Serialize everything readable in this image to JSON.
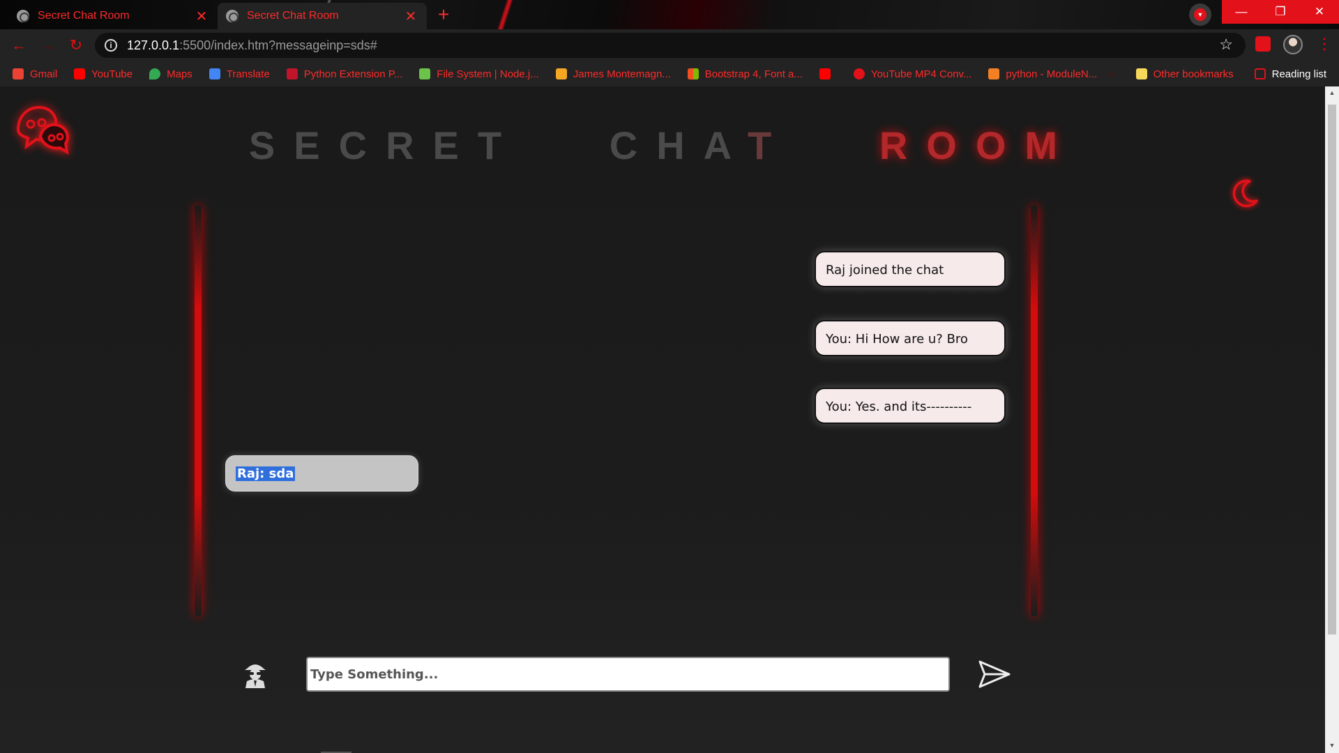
{
  "browser": {
    "tabs": [
      {
        "title": "Secret Chat Room",
        "active": false
      },
      {
        "title": "Secret Chat Room",
        "active": true
      }
    ],
    "url_host": "127.0.0.1",
    "url_rest": ":5500/index.htm?messageinp=sds#",
    "bookmarks": [
      {
        "label": "Gmail",
        "icon": "gmail-icon",
        "color": "#ea4335"
      },
      {
        "label": "YouTube",
        "icon": "youtube-icon",
        "color": "#ff0000"
      },
      {
        "label": "Maps",
        "icon": "maps-icon",
        "color": "#34a853"
      },
      {
        "label": "Translate",
        "icon": "translate-icon",
        "color": "#4285f4"
      },
      {
        "label": "Python Extension P...",
        "icon": "python-extension-icon",
        "color": "#c0142a"
      },
      {
        "label": "File System | Node.j...",
        "icon": "nodejs-icon",
        "color": "#6cc24a"
      },
      {
        "label": "James Montemagn...",
        "icon": "blog-icon",
        "color": "#f5a623"
      },
      {
        "label": "Bootstrap 4, Font a...",
        "icon": "windows-icon",
        "color": "#00a4ef"
      },
      {
        "label": "",
        "icon": "youtube-icon",
        "color": "#ff0000"
      },
      {
        "label": "YouTube MP4 Conv...",
        "icon": "download-icon",
        "color": "#e3111a"
      },
      {
        "label": "python - ModuleN...",
        "icon": "stackoverflow-icon",
        "color": "#f48024"
      }
    ],
    "other_bookmarks": "Other bookmarks",
    "reading_list": "Reading list"
  },
  "app": {
    "title_word1": "SECRET",
    "title_word2a": "CHA",
    "title_word2b": "T",
    "title_word3": "ROOM",
    "accent_color": "#e3111a",
    "messages": [
      {
        "side": "right",
        "text": "Raj joined the chat"
      },
      {
        "side": "right",
        "text": "You: Hi How are u? Bro"
      },
      {
        "side": "right",
        "text": "You: Yes. and its----------"
      },
      {
        "side": "left",
        "text": "Raj: sda",
        "selected": true
      }
    ],
    "input_placeholder": "Type Something...",
    "input_value": ""
  }
}
